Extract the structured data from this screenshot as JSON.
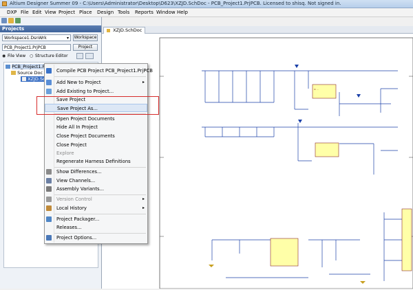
{
  "window": {
    "title": "Altium Designer Summer 09 - C:\\Users\\Administrator\\Desktop\\D623\\XZJD.SchDoc - PCB_Project1.PrjPCB. Licensed to shisq. Not signed in."
  },
  "menubar": {
    "items": [
      "DXP",
      "File",
      "Edit",
      "View",
      "Project",
      "Place",
      "Design",
      "Tools",
      "Reports",
      "Window",
      "Help"
    ]
  },
  "projects_panel": {
    "title": "Projects",
    "workspace_value": "Workspace1.DsnWrk",
    "workspace_button": "Workspace",
    "project_value": "PCB_Project1.PrjPCB",
    "project_button": "Project",
    "view_file": "File View",
    "view_structure": "Structure Editor",
    "tree": {
      "project": "PCB_Project1.PrjPCB *",
      "folder": "Source Doc",
      "document": "XZJD.Sc"
    }
  },
  "editor": {
    "active_tab": "XZJD.SchDoc"
  },
  "context_menu": {
    "items": [
      {
        "label": "Compile PCB Project PCB_Project1.PrjPCB",
        "icon": "compile-icon",
        "color": "#3a73c9"
      },
      {
        "label": "Add New to Project",
        "icon": "add-new-icon",
        "color": "#5a8ed6",
        "submenu": "▸"
      },
      {
        "label": "Add Existing to Project...",
        "icon": "add-existing-icon",
        "color": "#6aa0dc"
      },
      {
        "label": "Save Project"
      },
      {
        "label": "Save Project As..."
      },
      {
        "label": "Open Project Documents"
      },
      {
        "label": "Hide All In Project"
      },
      {
        "label": "Close Project Documents"
      },
      {
        "label": "Close Project"
      },
      {
        "label": "Explore"
      },
      {
        "label": "Regenerate Harness Definitions"
      },
      {
        "label": "Show Differences...",
        "icon": "differences-icon",
        "color": "#8a8a8a"
      },
      {
        "label": "View Channels...",
        "icon": "channels-icon",
        "color": "#6b7fa3"
      },
      {
        "label": "Assembly Variants...",
        "icon": "variants-icon",
        "color": "#7a7a7a"
      },
      {
        "label": "Version Control",
        "icon": "version-control-icon",
        "color": "#9a9a9a",
        "submenu": "▸"
      },
      {
        "label": "Local History",
        "icon": "history-icon",
        "color": "#c08a3a",
        "submenu": "▸"
      },
      {
        "label": "Project Packager...",
        "icon": "packager-icon",
        "color": "#4f86c6"
      },
      {
        "label": "Releases..."
      },
      {
        "label": "Project Options...",
        "icon": "options-icon",
        "color": "#4a78b8"
      }
    ]
  },
  "highlight_color": "#d62a2a"
}
